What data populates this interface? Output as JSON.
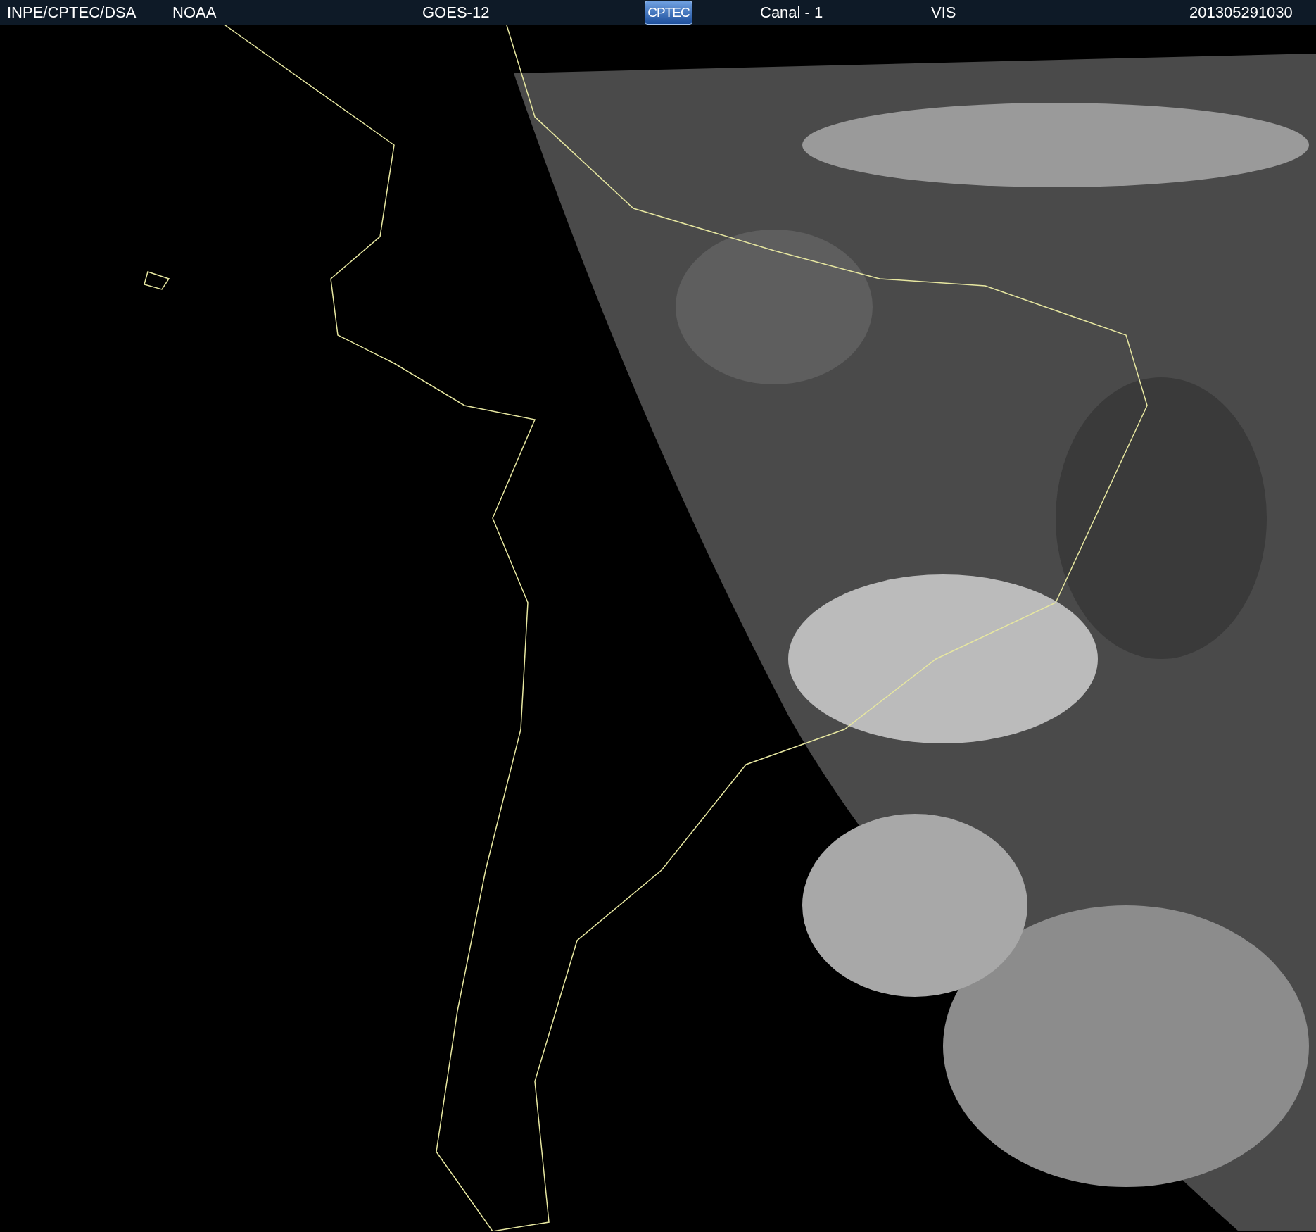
{
  "header": {
    "items": [
      {
        "kind": "text",
        "text": "INPE/CPTEC/DSA"
      },
      {
        "kind": "text",
        "text": "NOAA"
      },
      {
        "kind": "text",
        "text": "GOES-12"
      },
      {
        "kind": "logo",
        "text": "CPTEC"
      },
      {
        "kind": "text",
        "text": "Canal - 1"
      },
      {
        "kind": "text",
        "text": "VIS"
      },
      {
        "kind": "text",
        "text": "201305291030"
      }
    ]
  }
}
